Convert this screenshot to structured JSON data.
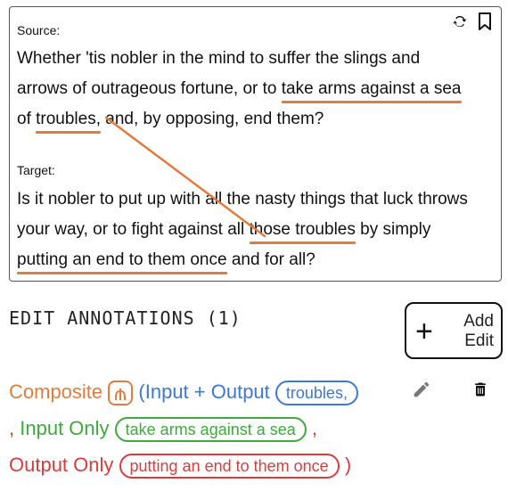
{
  "source": {
    "label": "Source:",
    "line1": "Whether 'tis nobler in the mind to suffer the slings and",
    "line2_pre": "arrows of outrageous fortune, or to ",
    "line2_hl": "take arms against a sea",
    "line3_pre": "of ",
    "line3_hl": "troubles,",
    "line3_post": " and, by opposing, end them?"
  },
  "target": {
    "label": "Target:",
    "line1": "Is it nobler to put up with all the nasty things that luck throws",
    "line2_pre": "your way, or to fight against all ",
    "line2_hl": "those troubles",
    "line2_post": " by simply",
    "line3_hl": "putting an end to them once",
    "line3_post": " and for all?"
  },
  "icons": {
    "refresh": "refresh-icon",
    "bookmark": "bookmark-icon",
    "pencil": "pencil-icon",
    "trash": "trash-icon",
    "composite": "merge-icon",
    "plus": "plus-icon"
  },
  "section": {
    "title": "EDIT ANNOTATIONS (1)"
  },
  "add_button": {
    "plus": "+",
    "line1": "Add",
    "line2": "Edit"
  },
  "annotation": {
    "composite_label": "Composite",
    "open_paren": "(",
    "input_output_label": "Input + Output",
    "input_output_chip": "troubles,",
    "comma1": ",",
    "input_only_label": "Input Only",
    "input_only_chip": "take arms against a sea",
    "comma2": ",",
    "output_only_label": "Output Only",
    "output_only_chip": "putting an end to them once",
    "close_paren": ")"
  },
  "colors": {
    "highlight": "#e07d3c",
    "blue": "#3b78d8",
    "green": "#3caa3c",
    "red": "#db3b3b"
  }
}
